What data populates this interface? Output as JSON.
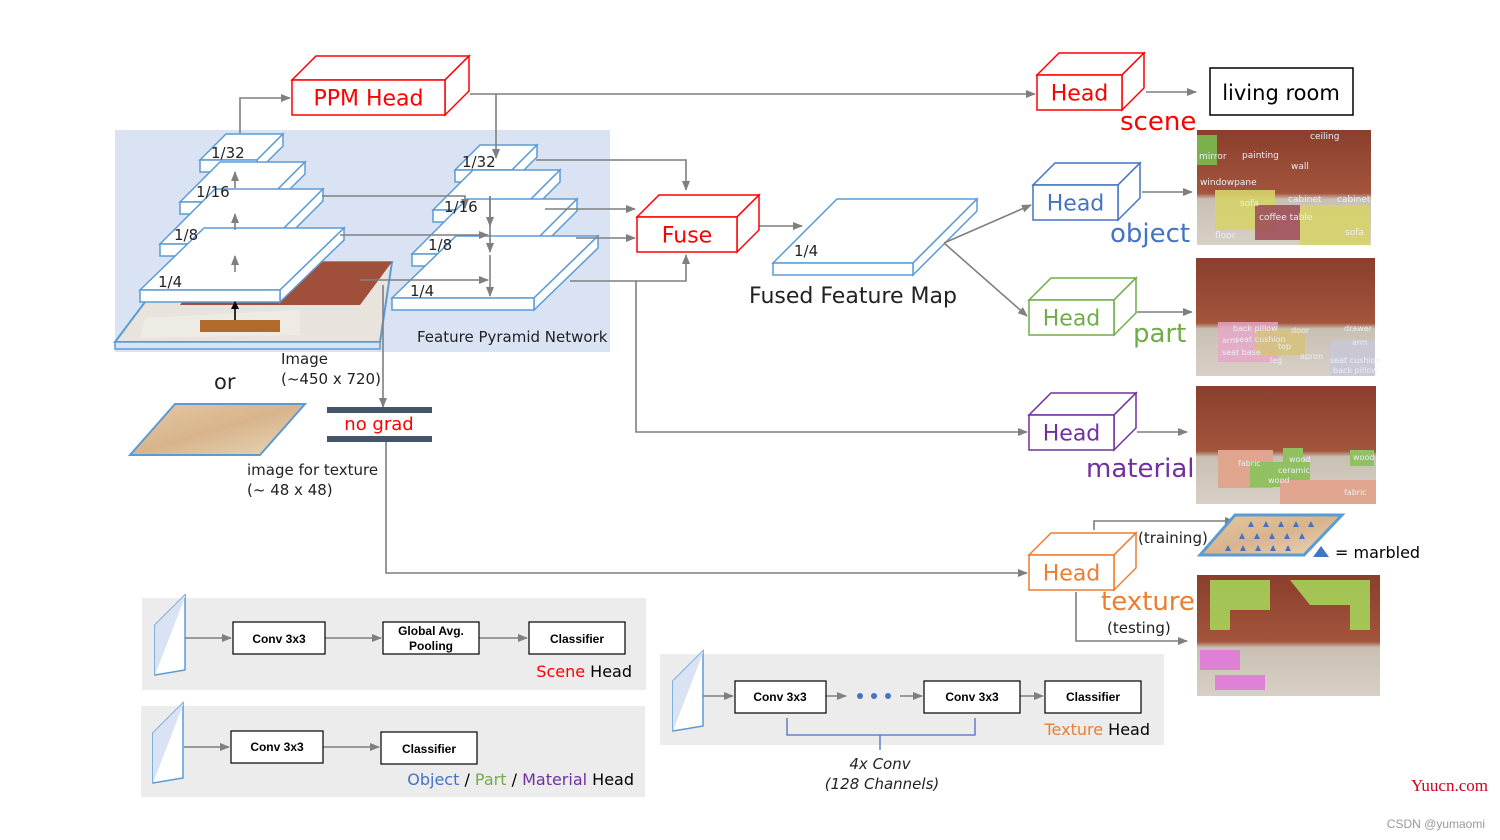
{
  "colors": {
    "fpn_bg": "#dae3f3",
    "slab": "#5b9bd5",
    "scene": "#ff0000",
    "object": "#4472c4",
    "part": "#70ad47",
    "material": "#7030a0",
    "texture": "#ed7d31",
    "panel": "#ececec"
  },
  "ppm": {
    "label": "PPM Head"
  },
  "fuse": {
    "label": "Fuse"
  },
  "fpn": {
    "label": "Feature Pyramid Network",
    "left_levels": [
      "1/32",
      "1/16",
      "1/8",
      "1/4"
    ],
    "right_levels": [
      "1/32",
      "1/16",
      "1/8",
      "1/4"
    ]
  },
  "image": {
    "label": "Image",
    "size": "(~450 x 720)",
    "or": "or",
    "texture_label": "image for texture",
    "texture_size": "(~ 48 x 48)"
  },
  "nograd": "no grad",
  "fused": {
    "scale": "1/4",
    "label": "Fused Feature Map"
  },
  "heads": {
    "scene": {
      "box": "Head",
      "name": "scene",
      "output": "living room"
    },
    "object": {
      "box": "Head",
      "name": "object",
      "labels": [
        "ceiling",
        "mirror",
        "painting",
        "wall",
        "windowpane",
        "sofa",
        "cabinet",
        "cabinet",
        "coffee table",
        "floor",
        "sofa"
      ]
    },
    "part": {
      "box": "Head",
      "name": "part",
      "labels": [
        "back pillow",
        "door",
        "drawer",
        "arm",
        "seat cushion",
        "top",
        "arm",
        "seat base",
        "leg",
        "apron",
        "seat cushion",
        "back pillow"
      ]
    },
    "material": {
      "box": "Head",
      "name": "material",
      "labels": [
        "fabric",
        "wood",
        "ceramic",
        "wood",
        "wood",
        "fabric"
      ]
    },
    "texture": {
      "box": "Head",
      "name": "texture",
      "training": "(training)",
      "testing": "(testing)",
      "legend": "= marbled"
    }
  },
  "panels": {
    "scene": {
      "blocks": [
        "Conv 3x3",
        "Global Avg.",
        "Pooling",
        "Classifier"
      ],
      "title": "Scene",
      "suffix": " Head"
    },
    "object": {
      "blocks": [
        "Conv 3x3",
        "Classifier"
      ],
      "title_object": "Object",
      "sep": " / ",
      "title_part": "Part",
      "title_material": "Material",
      "suffix": " Head"
    },
    "texture": {
      "blocks": [
        "Conv 3x3",
        "Conv 3x3",
        "Classifier"
      ],
      "title": "Texture",
      "suffix": " Head",
      "brace_line1": "4x Conv",
      "brace_line2": "(128 Channels)"
    }
  },
  "watermark": {
    "site": "Yuucn.com",
    "credit": "CSDN @yumaomi"
  }
}
